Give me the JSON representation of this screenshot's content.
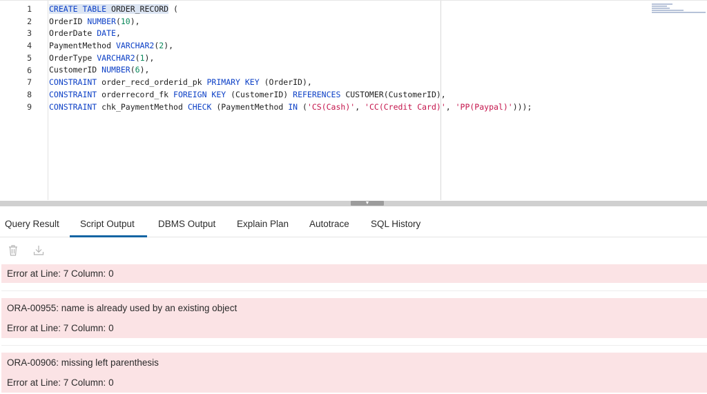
{
  "editor": {
    "line_numbers": [
      "1",
      "2",
      "3",
      "4",
      "5",
      "6",
      "7",
      "8",
      "9"
    ],
    "lines": [
      [
        {
          "t": "CREATE TABLE ",
          "c": "kw",
          "sel": true
        },
        {
          "t": "ORDER_RECORD",
          "c": "",
          "sel": true
        },
        {
          "t": " (",
          "c": ""
        }
      ],
      [
        {
          "t": "OrderID ",
          "c": ""
        },
        {
          "t": "NUMBER",
          "c": "kw"
        },
        {
          "t": "(",
          "c": ""
        },
        {
          "t": "10",
          "c": "num"
        },
        {
          "t": "),",
          "c": ""
        }
      ],
      [
        {
          "t": "OrderDate ",
          "c": ""
        },
        {
          "t": "DATE",
          "c": "kw"
        },
        {
          "t": ",",
          "c": ""
        }
      ],
      [
        {
          "t": "PaymentMethod ",
          "c": ""
        },
        {
          "t": "VARCHAR2",
          "c": "kw"
        },
        {
          "t": "(",
          "c": ""
        },
        {
          "t": "2",
          "c": "num"
        },
        {
          "t": "),",
          "c": ""
        }
      ],
      [
        {
          "t": "OrderType ",
          "c": ""
        },
        {
          "t": "VARCHAR2",
          "c": "kw"
        },
        {
          "t": "(",
          "c": ""
        },
        {
          "t": "1",
          "c": "num"
        },
        {
          "t": "),",
          "c": ""
        }
      ],
      [
        {
          "t": "CustomerID ",
          "c": ""
        },
        {
          "t": "NUMBER",
          "c": "kw"
        },
        {
          "t": "(",
          "c": ""
        },
        {
          "t": "6",
          "c": "num"
        },
        {
          "t": "),",
          "c": ""
        }
      ],
      [
        {
          "t": "CONSTRAINT",
          "c": "kw"
        },
        {
          "t": " order_recd_orderid_pk ",
          "c": ""
        },
        {
          "t": "PRIMARY KEY",
          "c": "kw"
        },
        {
          "t": " (OrderID),",
          "c": ""
        }
      ],
      [
        {
          "t": "CONSTRAINT",
          "c": "kw"
        },
        {
          "t": " orderrecord_fk ",
          "c": ""
        },
        {
          "t": "FOREIGN KEY",
          "c": "kw"
        },
        {
          "t": " (CustomerID) ",
          "c": ""
        },
        {
          "t": "REFERENCES",
          "c": "kw"
        },
        {
          "t": " CUSTOMER(CustomerID),",
          "c": ""
        }
      ],
      [
        {
          "t": "CONSTRAINT",
          "c": "kw"
        },
        {
          "t": " chk_PaymentMethod ",
          "c": ""
        },
        {
          "t": "CHECK",
          "c": "kw"
        },
        {
          "t": " (PaymentMethod ",
          "c": ""
        },
        {
          "t": "IN",
          "c": "kw"
        },
        {
          "t": " (",
          "c": ""
        },
        {
          "t": "'CS(Cash)'",
          "c": "str"
        },
        {
          "t": ", ",
          "c": ""
        },
        {
          "t": "'CC(Credit Card)'",
          "c": "str"
        },
        {
          "t": ", ",
          "c": ""
        },
        {
          "t": "'PP(Paypal)'",
          "c": "str"
        },
        {
          "t": ")));",
          "c": ""
        }
      ]
    ]
  },
  "tabs": [
    {
      "label": "Query Result",
      "active": false
    },
    {
      "label": "Script Output",
      "active": true
    },
    {
      "label": "DBMS Output",
      "active": false
    },
    {
      "label": "Explain Plan",
      "active": false
    },
    {
      "label": "Autotrace",
      "active": false
    },
    {
      "label": "SQL History",
      "active": false
    }
  ],
  "toolbar": {
    "icons": [
      "trash-icon",
      "download-icon"
    ]
  },
  "output": {
    "block1": {
      "line1": "Error at Line: 7 Column: 0"
    },
    "block2": {
      "line1": "ORA-00955: name is already used by an existing object",
      "line2": "Error at Line: 7 Column: 0"
    },
    "block3": {
      "line1": "ORA-00906: missing left parenthesis",
      "line2": "Error at Line: 7 Column: 0"
    }
  },
  "colors": {
    "keyword": "#0b3fc6",
    "number": "#09885a",
    "string": "#c4144b",
    "error_bg": "#fbe3e5",
    "active_tab": "#1264a3"
  }
}
